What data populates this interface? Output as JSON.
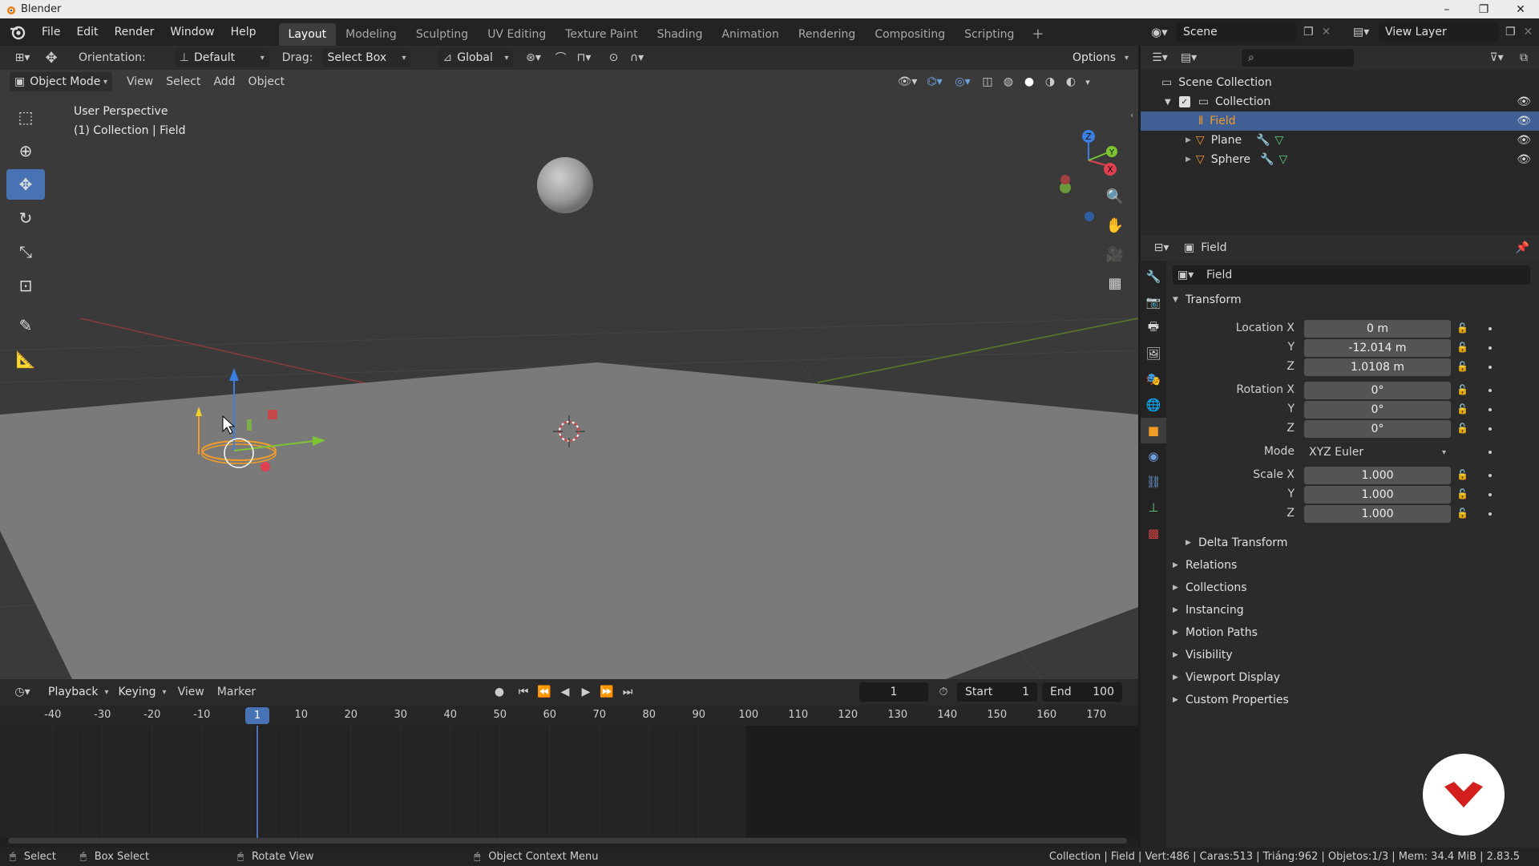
{
  "window": {
    "title": "Blender",
    "controls": [
      "–",
      "❐",
      "✕"
    ]
  },
  "menubar": {
    "menus": [
      "File",
      "Edit",
      "Render",
      "Window",
      "Help"
    ],
    "workspaces": [
      "Layout",
      "Modeling",
      "Sculpting",
      "UV Editing",
      "Texture Paint",
      "Shading",
      "Animation",
      "Rendering",
      "Compositing",
      "Scripting"
    ],
    "active_workspace": "Layout",
    "add_tab": "+",
    "scene": "Scene",
    "view_layer": "View Layer"
  },
  "viewport": {
    "header": {
      "orientation_label": "Orientation:",
      "orientation_value": "Default",
      "drag_label": "Drag:",
      "drag_value": "Select Box",
      "transform_orientation": "Global",
      "options": "Options"
    },
    "header2": {
      "mode": "Object Mode",
      "menus": [
        "View",
        "Select",
        "Add",
        "Object"
      ]
    },
    "info": {
      "perspective": "User Perspective",
      "context": "(1) Collection | Field"
    },
    "gizmo_axes": {
      "x": "X",
      "y": "Y",
      "z": "Z"
    },
    "colors": {
      "background": "#393939",
      "plane": "#7a7a7a",
      "selection": "#f29c26",
      "x_axis": "#e04050",
      "y_axis": "#7ec534",
      "z_axis": "#3a7fe0"
    }
  },
  "timeline": {
    "menus": [
      "Playback",
      "Keying",
      "View",
      "Marker"
    ],
    "current_frame": "1",
    "start_label": "Start",
    "start_value": "1",
    "end_label": "End",
    "end_value": "100",
    "ruler_labels": [
      "-40",
      "-30",
      "-20",
      "-10",
      "10",
      "20",
      "30",
      "40",
      "50",
      "60",
      "70",
      "80",
      "90",
      "100",
      "110",
      "120",
      "130",
      "140",
      "150",
      "160",
      "170"
    ],
    "playhead_label": "1"
  },
  "outliner": {
    "root": "Scene Collection",
    "collection": "Collection",
    "items": [
      {
        "name": "Field",
        "selected": true
      },
      {
        "name": "Plane",
        "selected": false
      },
      {
        "name": "Sphere",
        "selected": false
      }
    ]
  },
  "properties": {
    "object_name": "Field",
    "datablock_name": "Field",
    "transform_title": "Transform",
    "location": {
      "label": "Location X",
      "x": "0 m",
      "y": "-12.014 m",
      "z": "1.0108 m"
    },
    "rotation": {
      "label": "Rotation X",
      "x": "0°",
      "y": "0°",
      "z": "0°"
    },
    "mode_label": "Mode",
    "mode_value": "XYZ Euler",
    "scale": {
      "label": "Scale X",
      "x": "1.000",
      "y": "1.000",
      "z": "1.000"
    },
    "axis_y": "Y",
    "axis_z": "Z",
    "delta_transform": "Delta Transform",
    "panels": [
      "Relations",
      "Collections",
      "Instancing",
      "Motion Paths",
      "Visibility",
      "Viewport Display",
      "Custom Properties"
    ]
  },
  "statusbar": {
    "select": "Select",
    "box_select": "Box Select",
    "rotate_view": "Rotate View",
    "context_menu": "Object Context Menu",
    "stats": "Collection | Field | Vert:486 | Caras:513 | Triáng:962 | Objetos:1/3 | Mem: 34.4 MiB | 2.83.5"
  }
}
